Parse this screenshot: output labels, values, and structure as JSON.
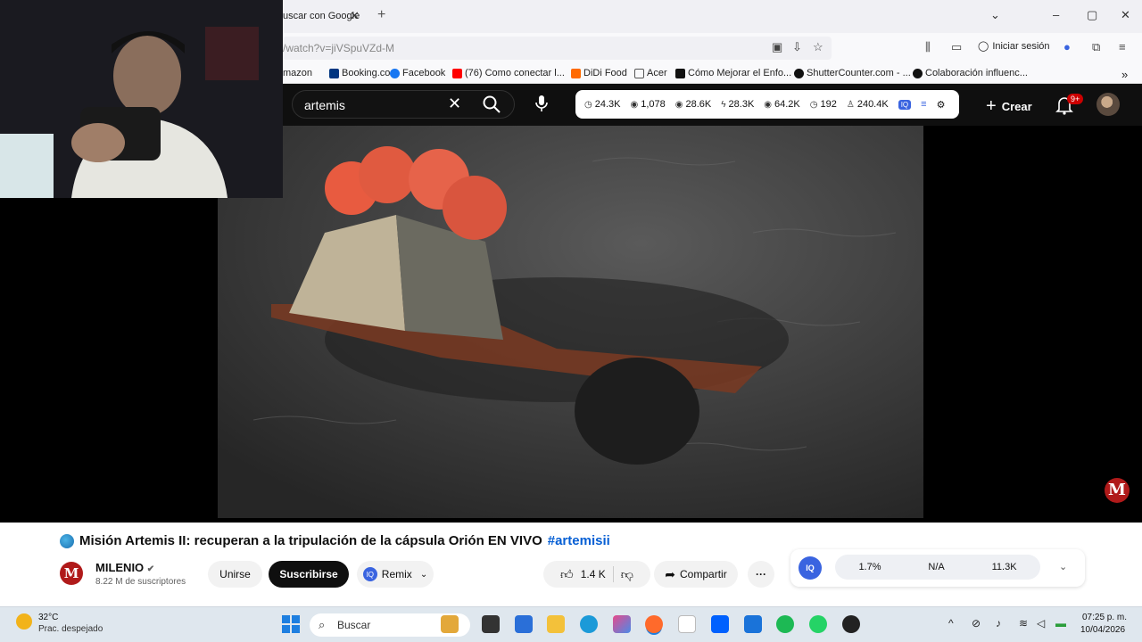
{
  "browser": {
    "tab_title": "uscar con Google",
    "url": "/watch?v=jiVSpuVZd-M",
    "signin_label": "Iniciar sesión",
    "bookmarks": [
      {
        "label": "mazon",
        "color": "#ff9900"
      },
      {
        "label": "Booking.com",
        "color": "#003580"
      },
      {
        "label": "Facebook",
        "color": "#1877f2"
      },
      {
        "label": "(76) Como conectar l...",
        "color": "#ff0000"
      },
      {
        "label": "DiDi Food",
        "color": "#ff6a00"
      },
      {
        "label": "Acer",
        "color": "#ffffff"
      },
      {
        "label": "Cómo Mejorar el Enfo...",
        "color": "#111111"
      },
      {
        "label": "ShutterCounter.com - ...",
        "color": "#111111"
      },
      {
        "label": "Colaboración influenc...",
        "color": "#111111"
      }
    ]
  },
  "youtube": {
    "search_query": "artemis",
    "stats": [
      "24.3K",
      "1,078",
      "28.6K",
      "28.3K",
      "64.2K",
      "192",
      "240.4K"
    ],
    "create_label": "Crear",
    "notif_badge": "9+"
  },
  "video": {
    "title": "Misión Artemis II: recuperan a la tripulación de la cápsula Orión EN VIVO",
    "hashtag": "#artemisii",
    "channel_name": "MILENIO",
    "channel_subs": "8.22 M de suscriptores",
    "watermark_letter": "M",
    "join_label": "Unirse",
    "subscribe_label": "Suscribirse",
    "remix_label": "Remix",
    "like_count": "1.4 K",
    "share_label": "Compartir",
    "iq_metrics": [
      "1.7%",
      "N/A",
      "11.3K"
    ],
    "iq_logo": "IQ"
  },
  "taskbar": {
    "temperature": "32°C",
    "weather": "Prac. despejado",
    "search_label": "Buscar",
    "time": "07:25 p. m.",
    "date": "10/04/2026"
  }
}
